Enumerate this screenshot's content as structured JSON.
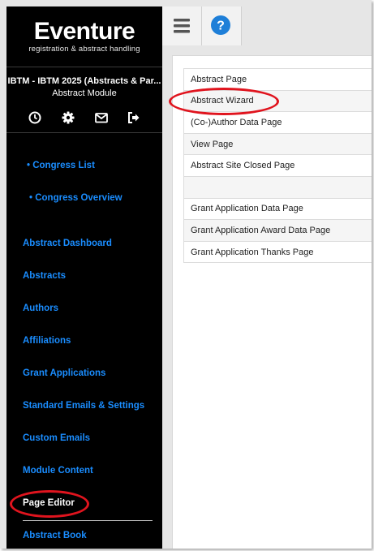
{
  "app": {
    "name": "Eventure",
    "tagline": "registration & abstract handling",
    "event_title": "IBTM - IBTM 2025 (Abstracts & Par...",
    "module_title": "Abstract Module"
  },
  "header_icons": [
    "clock-icon",
    "gear-icon",
    "envelope-icon",
    "logout-icon"
  ],
  "sidebar": {
    "sub_items": [
      {
        "label": "• Congress List"
      },
      {
        "label": "• Congress Overview"
      }
    ],
    "items": [
      {
        "label": "Abstract Dashboard"
      },
      {
        "label": "Abstracts"
      },
      {
        "label": "Authors"
      },
      {
        "label": "Affiliations"
      },
      {
        "label": "Grant Applications"
      },
      {
        "label": "Standard Emails & Settings"
      },
      {
        "label": "Custom Emails"
      },
      {
        "label": "Module Content"
      },
      {
        "label": "Page Editor"
      },
      {
        "label": "Abstract Book"
      }
    ],
    "active_item": "Page Editor"
  },
  "topbar": {
    "menu_icon": "hamburger-icon",
    "help_icon": "help-icon"
  },
  "pages_table": {
    "rows": [
      "Abstract Page",
      "Abstract Wizard",
      "(Co-)Author Data Page",
      "View Page",
      "Abstract Site Closed Page",
      "",
      "Grant Application Data Page",
      "Grant Application Award Data Page",
      "Grant Application Thanks Page"
    ]
  },
  "colors": {
    "sidebar_bg": "#000000",
    "link": "#1a8dff",
    "highlight_circle": "#e0141e",
    "help_icon": "#1e7fd8"
  }
}
